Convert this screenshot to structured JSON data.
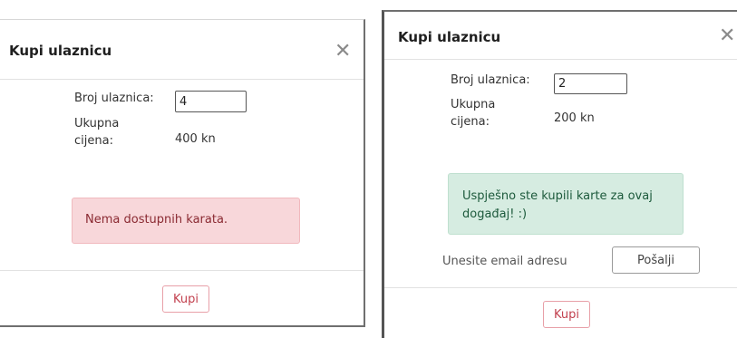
{
  "left_modal": {
    "title": "Kupi ulaznicu",
    "close_icon": "close-icon",
    "quantity_label": "Broj ulaznica:",
    "quantity_value": "4",
    "total_label_line1": "Ukupna",
    "total_label_line2": "cijena:",
    "total_value": "400 kn",
    "alert_text": "Nema dostupnih karata.",
    "buy_label": "Kupi"
  },
  "right_modal": {
    "title": "Kupi ulaznicu",
    "close_icon": "close-icon",
    "quantity_label": "Broj ulaznica:",
    "quantity_value": "2",
    "total_label_line1": "Ukupna",
    "total_label_line2": "cijena:",
    "total_value": "200 kn",
    "alert_line1": "Uspješno ste kupili karte za ovaj",
    "alert_line2": "događaj! :)",
    "email_placeholder": "Unesite email adresu",
    "send_label": "Pošalji",
    "buy_label": "Kupi"
  },
  "colors": {
    "danger_bg": "#f8d7da",
    "success_bg": "#d6ece1",
    "buy_accent": "#c2414f"
  }
}
